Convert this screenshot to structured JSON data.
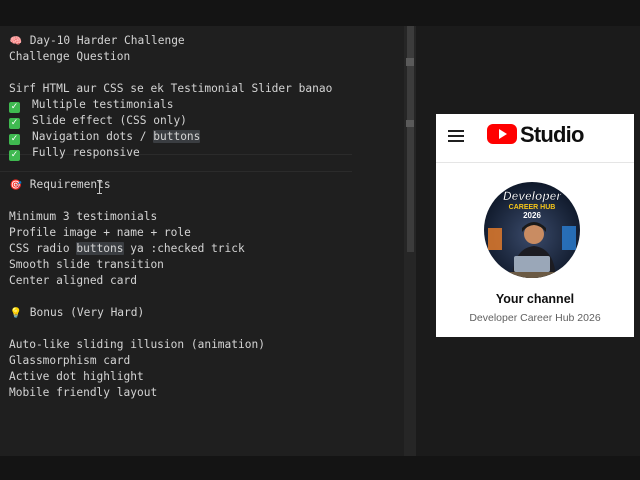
{
  "editor": {
    "lines": [
      {
        "icon": "brain",
        "text": "Day-10 Harder Challenge"
      },
      {
        "text": "Challenge Question"
      },
      {
        "text": "Sirf HTML aur CSS se ek Testimonial Slider banao"
      },
      {
        "text": "Multiple testimonials"
      },
      {
        "text": "Slide effect (CSS only)"
      },
      {
        "text_pre": "Navigation dots / ",
        "text_hl": "buttons"
      },
      {
        "text": "Fully responsive"
      },
      {
        "icon": "target",
        "text": "Requirements"
      },
      {
        "text": "Minimum 3 testimonials"
      },
      {
        "text": "Profile image + name + role"
      },
      {
        "text_pre": "CSS radio ",
        "text_hl": "buttons",
        "text_post": " ya :checked trick"
      },
      {
        "text": "Smooth slide transition"
      },
      {
        "text": "Center aligned card"
      },
      {
        "icon": "bulb",
        "text": "Bonus (Very Hard)"
      },
      {
        "text": "Auto-like sliding illusion (animation)"
      },
      {
        "text": "Glassmorphism card"
      },
      {
        "text": "Active dot highlight"
      },
      {
        "text": "Mobile friendly layout"
      }
    ]
  },
  "icons": {
    "brain": "brain-icon",
    "target": "target-icon",
    "bulb": "lightbulb-icon",
    "check": "check-mark-icon"
  },
  "studio": {
    "brand": "Studio",
    "avatar_line1": "Developer",
    "avatar_line2": "CAREER HUB",
    "avatar_line3": "2026",
    "channel_title": "Your channel",
    "channel_name": "Developer Career Hub 2026"
  },
  "colors": {
    "editor_bg": "#1f1f1f",
    "text": "#d4d4d4",
    "check_green": "#3fb950",
    "youtube_red": "#ff0000"
  }
}
